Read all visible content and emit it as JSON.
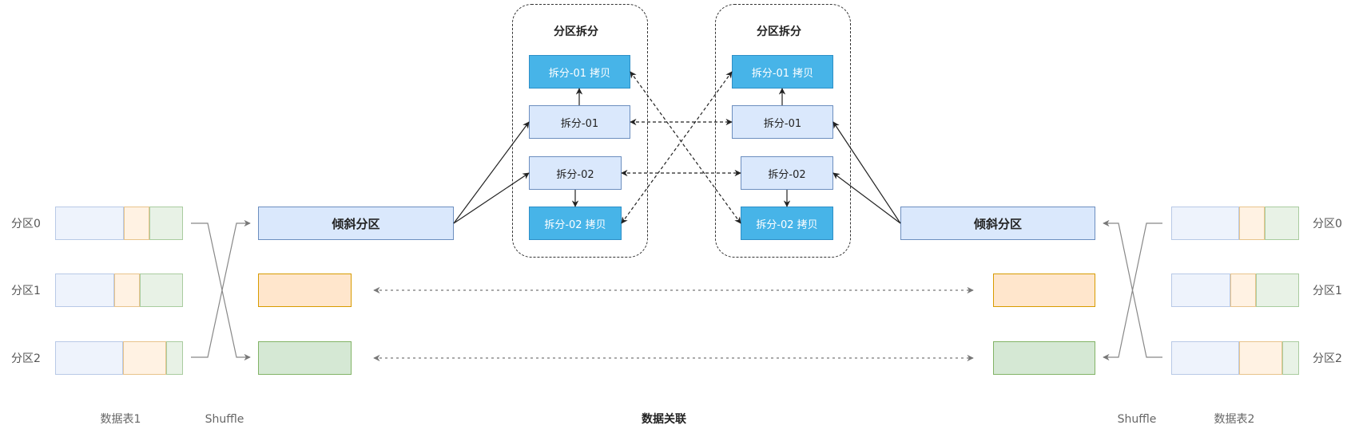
{
  "left_table": {
    "caption": "数据表1",
    "shuffle_label": "Shuffle",
    "partitions": [
      {
        "label": "分区0",
        "segments": [
          {
            "color": "blue",
            "share": 0.54
          },
          {
            "color": "orange",
            "share": 0.2
          },
          {
            "color": "green",
            "share": 0.26
          }
        ]
      },
      {
        "label": "分区1",
        "segments": [
          {
            "color": "blue",
            "share": 0.46
          },
          {
            "color": "orange",
            "share": 0.2
          },
          {
            "color": "green",
            "share": 0.34
          }
        ]
      },
      {
        "label": "分区2",
        "segments": [
          {
            "color": "blue",
            "share": 0.53
          },
          {
            "color": "orange",
            "share": 0.34
          },
          {
            "color": "green",
            "share": 0.13
          }
        ]
      }
    ]
  },
  "right_table": {
    "caption": "数据表2",
    "shuffle_label": "Shuffle",
    "partitions": [
      {
        "label": "分区0",
        "segments": [
          {
            "color": "blue",
            "share": 0.53
          },
          {
            "color": "orange",
            "share": 0.2
          },
          {
            "color": "green",
            "share": 0.27
          }
        ]
      },
      {
        "label": "分区1",
        "segments": [
          {
            "color": "blue",
            "share": 0.46
          },
          {
            "color": "orange",
            "share": 0.2
          },
          {
            "color": "green",
            "share": 0.34
          }
        ]
      },
      {
        "label": "分区2",
        "segments": [
          {
            "color": "blue",
            "share": 0.53
          },
          {
            "color": "orange",
            "share": 0.34
          },
          {
            "color": "green",
            "share": 0.13
          }
        ]
      }
    ]
  },
  "skew_left": {
    "label": "倾斜分区"
  },
  "skew_right": {
    "label": "倾斜分区"
  },
  "split_groups": [
    {
      "title": "分区拆分",
      "copy1": "拆分-01 拷贝",
      "split1": "拆分-01",
      "split2": "拆分-02",
      "copy2": "拆分-02 拷贝"
    },
    {
      "title": "分区拆分",
      "copy1": "拆分-01 拷贝",
      "split1": "拆分-01",
      "split2": "拆分-02",
      "copy2": "拆分-02 拷贝"
    }
  ],
  "center_caption": "数据关联",
  "colors": {
    "blue_fill": "#eef3fc",
    "blue_stroke": "#b8c9e6",
    "orange_fill": "#fff2e3",
    "orange_stroke": "#e8c48c",
    "green_fill": "#e8f2e6",
    "green_stroke": "#a9cc9f",
    "copy_fill": "#47b4e8"
  }
}
